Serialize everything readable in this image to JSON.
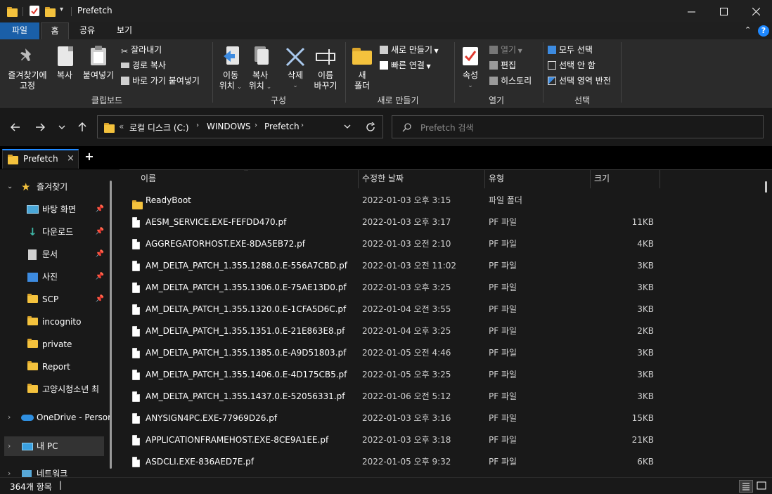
{
  "title_bar": {
    "title": "Prefetch",
    "minimize": "—",
    "maximize": "☐",
    "close": "✕"
  },
  "ribbon_tabs": [
    "파일",
    "홈",
    "공유",
    "보기"
  ],
  "ribbon": {
    "clipboard": {
      "pin_label_1": "즐겨찾기에",
      "pin_label_2": "고정",
      "copy": "복사",
      "paste": "붙여넣기",
      "cut": "잘라내기",
      "copy_path": "경로 복사",
      "paste_shortcut": "바로 가기 붙여넣기",
      "group": "클립보드"
    },
    "organize": {
      "move_1": "이동",
      "move_2": "위치",
      "copy_1": "복사",
      "copy_2": "위치",
      "delete": "삭제",
      "rename_1": "이름",
      "rename_2": "바꾸기",
      "group": "구성"
    },
    "new": {
      "new_folder_1": "새",
      "new_folder_2": "폴더",
      "new_item": "새로 만들기",
      "easy_access": "빠른 연결",
      "group": "새로 만들기"
    },
    "open": {
      "properties": "속성",
      "open": "열기",
      "edit": "편집",
      "history": "히스토리",
      "group": "열기"
    },
    "select": {
      "select_all": "모두 선택",
      "select_none": "선택 안 함",
      "invert": "선택 영역 반전",
      "group": "선택"
    }
  },
  "address": {
    "overflow": "«",
    "crumbs": [
      "로컬 디스크 (C:)",
      "WINDOWS",
      "Prefetch"
    ],
    "search_placeholder": "Prefetch 검색"
  },
  "tab": {
    "label": "Prefetch",
    "close": "×",
    "add": "+"
  },
  "nav": {
    "quick_access": "즐겨찾기",
    "items": [
      "바탕 화면",
      "다운로드",
      "문서",
      "사진",
      "SCP",
      "incognito",
      "private",
      "Report",
      "고양시청소년 최"
    ],
    "onedrive": "OneDrive - Persor",
    "this_pc": "내 PC",
    "network": "네트워크"
  },
  "columns": {
    "name": "이름",
    "date": "수정한 날짜",
    "type": "유형",
    "size": "크기"
  },
  "files": [
    {
      "name": "ReadyBoot",
      "date": "2022-01-03 오후 3:15",
      "type": "파일 폴더",
      "size": "",
      "kind": "folder"
    },
    {
      "name": "AESM_SERVICE.EXE-FEFDD470.pf",
      "date": "2022-01-03 오후 3:17",
      "type": "PF 파일",
      "size": "11KB",
      "kind": "file"
    },
    {
      "name": "AGGREGATORHOST.EXE-8DA5EB72.pf",
      "date": "2022-01-03 오전 2:10",
      "type": "PF 파일",
      "size": "4KB",
      "kind": "file"
    },
    {
      "name": "AM_DELTA_PATCH_1.355.1288.0.E-556A7CBD.pf",
      "date": "2022-01-03 오전 11:02",
      "type": "PF 파일",
      "size": "3KB",
      "kind": "file"
    },
    {
      "name": "AM_DELTA_PATCH_1.355.1306.0.E-75AE13D0.pf",
      "date": "2022-01-03 오후 3:25",
      "type": "PF 파일",
      "size": "3KB",
      "kind": "file"
    },
    {
      "name": "AM_DELTA_PATCH_1.355.1320.0.E-1CFA5D6C.pf",
      "date": "2022-01-04 오전 3:55",
      "type": "PF 파일",
      "size": "3KB",
      "kind": "file"
    },
    {
      "name": "AM_DELTA_PATCH_1.355.1351.0.E-21E863E8.pf",
      "date": "2022-01-04 오후 3:25",
      "type": "PF 파일",
      "size": "2KB",
      "kind": "file"
    },
    {
      "name": "AM_DELTA_PATCH_1.355.1385.0.E-A9D51803.pf",
      "date": "2022-01-05 오전 4:46",
      "type": "PF 파일",
      "size": "3KB",
      "kind": "file"
    },
    {
      "name": "AM_DELTA_PATCH_1.355.1406.0.E-4D175CB5.pf",
      "date": "2022-01-05 오후 3:25",
      "type": "PF 파일",
      "size": "3KB",
      "kind": "file"
    },
    {
      "name": "AM_DELTA_PATCH_1.355.1437.0.E-52056331.pf",
      "date": "2022-01-06 오전 5:12",
      "type": "PF 파일",
      "size": "3KB",
      "kind": "file"
    },
    {
      "name": "ANYSIGN4PC.EXE-77969D26.pf",
      "date": "2022-01-03 오후 3:16",
      "type": "PF 파일",
      "size": "15KB",
      "kind": "file"
    },
    {
      "name": "APPLICATIONFRAMEHOST.EXE-8CE9A1EE.pf",
      "date": "2022-01-03 오후 3:18",
      "type": "PF 파일",
      "size": "21KB",
      "kind": "file"
    },
    {
      "name": "ASDCLI.EXE-836AED7E.pf",
      "date": "2022-01-05 오후 9:32",
      "type": "PF 파일",
      "size": "6KB",
      "kind": "file"
    }
  ],
  "status": {
    "count": "364개 항목",
    "cursor": "|"
  },
  "colors": {
    "accent": "#1a5fa8",
    "folder": "#f4c23d",
    "background": "#191919"
  }
}
